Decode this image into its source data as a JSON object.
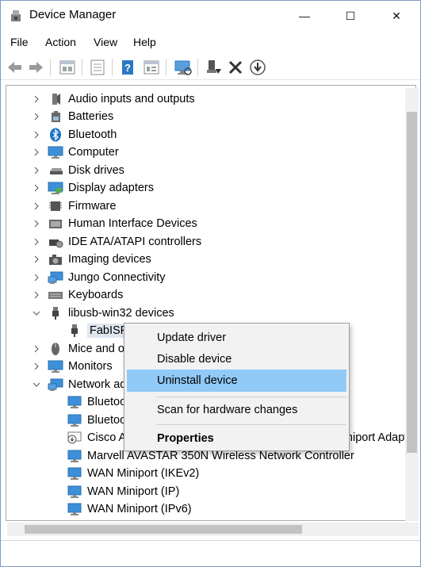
{
  "window": {
    "title": "Device Manager",
    "title_icon": "device-manager-icon"
  },
  "titlebar_buttons": {
    "minimize": "—",
    "maximize": "☐",
    "close": "✕"
  },
  "menu": [
    "File",
    "Action",
    "View",
    "Help"
  ],
  "toolbar": [
    "back-arrow-icon",
    "forward-arrow-icon",
    "properties-sheet-icon",
    "device-list-icon",
    "help-icon",
    "properties-icon",
    "scan-hardware-icon",
    "update-driver-icon",
    "uninstall-icon",
    "disable-device-icon"
  ],
  "tree": [
    {
      "label": "Audio inputs and outputs",
      "icon": "speaker-icon",
      "state": "collapsed"
    },
    {
      "label": "Batteries",
      "icon": "battery-icon",
      "state": "collapsed"
    },
    {
      "label": "Bluetooth",
      "icon": "bluetooth-icon",
      "state": "collapsed"
    },
    {
      "label": "Computer",
      "icon": "monitor-icon",
      "state": "collapsed"
    },
    {
      "label": "Disk drives",
      "icon": "disk-drive-icon",
      "state": "collapsed"
    },
    {
      "label": "Display adapters",
      "icon": "display-adapter-icon",
      "state": "collapsed"
    },
    {
      "label": "Firmware",
      "icon": "firmware-chip-icon",
      "state": "collapsed"
    },
    {
      "label": "Human Interface Devices",
      "icon": "hid-icon",
      "state": "collapsed"
    },
    {
      "label": "IDE ATA/ATAPI controllers",
      "icon": "ide-controller-icon",
      "state": "collapsed"
    },
    {
      "label": "Imaging devices",
      "icon": "camera-icon",
      "state": "collapsed"
    },
    {
      "label": "Jungo Connectivity",
      "icon": "network-monitor-icon",
      "state": "collapsed"
    },
    {
      "label": "Keyboards",
      "icon": "keyboard-icon",
      "state": "collapsed"
    },
    {
      "label": "libusb-win32 devices",
      "icon": "usb-plug-icon",
      "state": "expanded"
    },
    {
      "label": "FabISP",
      "icon": "usb-device-icon",
      "state": "child-selected"
    },
    {
      "label": "Mice and other pointing devices",
      "icon": "mouse-icon",
      "state": "collapsed"
    },
    {
      "label": "Monitors",
      "icon": "monitor-icon",
      "state": "collapsed"
    },
    {
      "label": "Network adapters",
      "icon": "network-monitor-icon",
      "state": "expanded"
    },
    {
      "label": "Bluetooth Device (Personal Area Network)",
      "icon": "network-adapter-icon",
      "state": "child"
    },
    {
      "label": "Bluetooth Device (RFCOMM Protocol TDI)",
      "icon": "network-adapter-icon",
      "state": "child"
    },
    {
      "label": "Cisco AnyConnect Secure Mobility Client Virtual Miniport Adapter",
      "icon": "network-adapter-warning-icon",
      "state": "child"
    },
    {
      "label": "Marvell AVASTAR 350N Wireless Network Controller",
      "icon": "network-adapter-icon",
      "state": "child"
    },
    {
      "label": "WAN Miniport (IKEv2)",
      "icon": "network-adapter-icon",
      "state": "child"
    },
    {
      "label": "WAN Miniport (IP)",
      "icon": "network-adapter-icon",
      "state": "child"
    },
    {
      "label": "WAN Miniport (IPv6)",
      "icon": "network-adapter-icon",
      "state": "child"
    }
  ],
  "context_menu": {
    "items": [
      {
        "label": "Update driver",
        "highlight": false,
        "bold": false
      },
      {
        "label": "Disable device",
        "highlight": false,
        "bold": false
      },
      {
        "label": "Uninstall device",
        "highlight": true,
        "bold": false
      },
      {
        "label": "Scan for hardware changes",
        "highlight": false,
        "bold": false
      },
      {
        "label": "Properties",
        "highlight": false,
        "bold": true
      }
    ]
  },
  "colors": {
    "highlight": "#91c9f7",
    "selection": "#dfe6ee",
    "icon_blue": "#2b79c2"
  }
}
